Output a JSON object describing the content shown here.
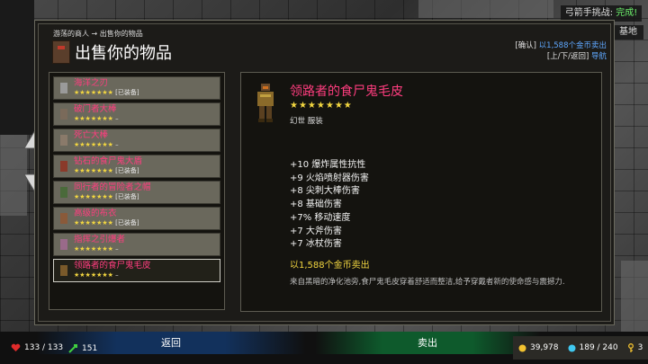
{
  "quest": {
    "label": "弓箭手挑战:",
    "status": "完成!"
  },
  "base_label": "基地",
  "breadcrumb": "游荡的商人 → 出售你的物品",
  "title": "出售你的物品",
  "help": {
    "line1_key": "[确认]",
    "line1_text": "以1,588个金币卖出",
    "line2_key": "[上/下/返回]",
    "line2_text": "导航"
  },
  "items": [
    {
      "name": "海洋之刃",
      "stars": "★★★★★★★",
      "note": "[已装备]",
      "icon": "sword-icon",
      "color": "#9a9a9a"
    },
    {
      "name": "破门者大棒",
      "stars": "★★★★★★★",
      "note": "–",
      "icon": "club-icon",
      "color": "#7a6a5a"
    },
    {
      "name": "死亡大棒",
      "stars": "★★★★★★★",
      "note": "–",
      "icon": "club-icon",
      "color": "#8a7a6a"
    },
    {
      "name": "钻石的食尸鬼大盾",
      "stars": "★★★★★★★",
      "note": "[已装备]",
      "icon": "shield-icon",
      "color": "#8a3a2a"
    },
    {
      "name": "同行者的冒险者之帽",
      "stars": "★★★★★★★",
      "note": "[已装备]",
      "icon": "hat-icon",
      "color": "#4a6a3a"
    },
    {
      "name": "高级的布衣",
      "stars": "★★★★★★★",
      "note": "[已装备]",
      "icon": "cloth-icon",
      "color": "#8a5a3a"
    },
    {
      "name": "指挥之引爆者",
      "stars": "★★★★★★★",
      "note": "–",
      "icon": "trinket-icon",
      "color": "#9a6a8a"
    },
    {
      "name": "领路者的食尸鬼毛皮",
      "stars": "★★★★★★★",
      "note": "–",
      "icon": "fur-armor-icon",
      "color": "#7a5a2a",
      "selected": true
    }
  ],
  "detail": {
    "name": "领路者的食尸鬼毛皮",
    "stars": "★★★★★★★",
    "type": "幻世 服装",
    "stats": [
      "+10 爆炸属性抗性",
      "+9 火焰喷射器伤害",
      "+8 尖刺大棒伤害",
      "+8 基础伤害",
      "+7% 移动速度",
      "+7 大斧伤害",
      "+7 冰杖伤害"
    ],
    "sell_price": "以1,588个金币卖出",
    "description": "来自黑暗的净化池旁,食尸鬼毛皮穿着舒适而整洁,给予穿戴者新的使命感与震撼力."
  },
  "buttons": {
    "back": "返回",
    "sell": "卖出"
  },
  "status": {
    "health": "133 / 133",
    "ammo": "151",
    "gold": "39,978",
    "gems": "189 / 240",
    "keys": "3"
  },
  "colors": {
    "rarity_pink": "#ff3d7f",
    "star_yellow": "#f2d640",
    "nav_blue": "#5fa8ff",
    "done_green": "#6cf06c"
  }
}
